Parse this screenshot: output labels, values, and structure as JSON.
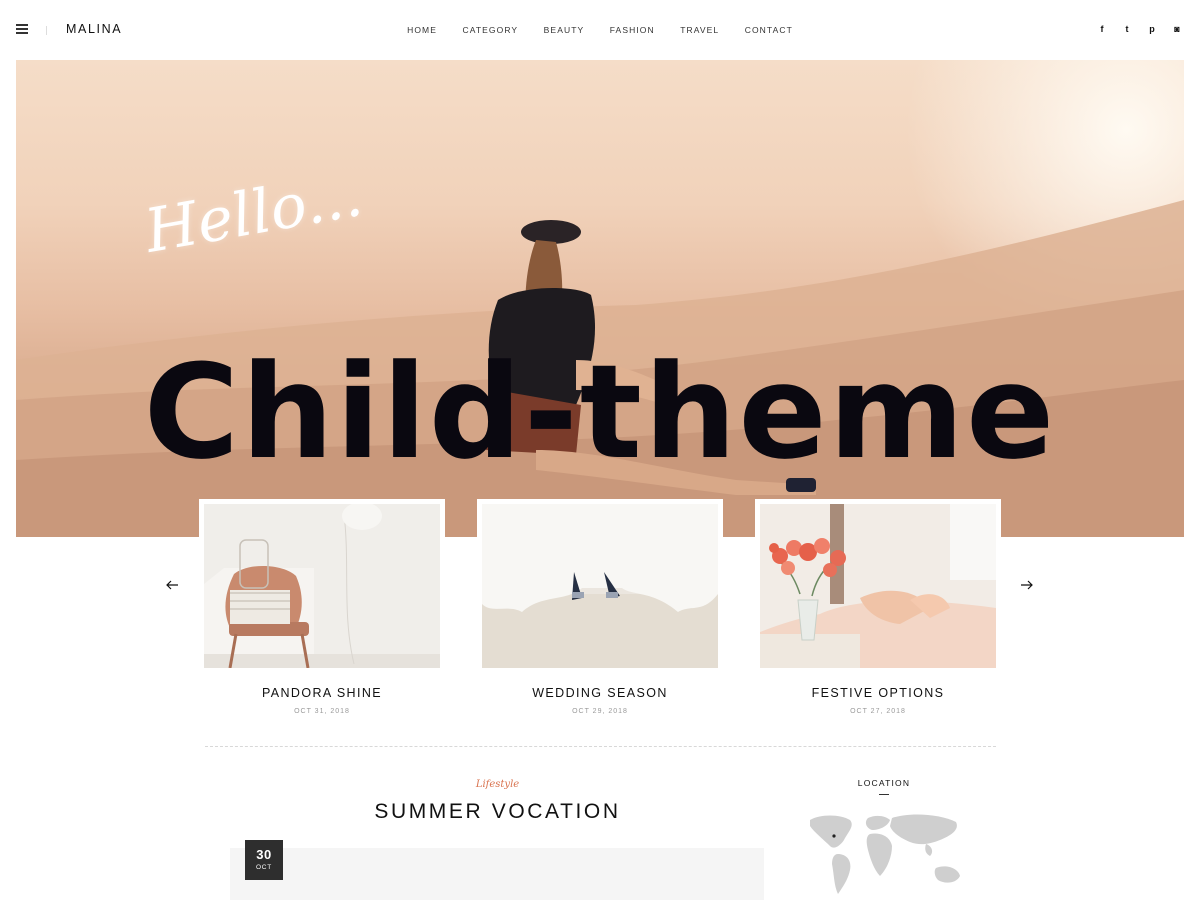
{
  "site": {
    "logo": "MALINA"
  },
  "nav": [
    "HOME",
    "CATEGORY",
    "BEAUTY",
    "FASHION",
    "TRAVEL",
    "CONTACT"
  ],
  "social": [
    {
      "icon": "facebook-icon",
      "glyph": "f"
    },
    {
      "icon": "twitter-icon",
      "glyph": "t"
    },
    {
      "icon": "pinterest-icon",
      "glyph": "p"
    },
    {
      "icon": "instagram-icon",
      "glyph": "◙"
    }
  ],
  "hero": {
    "greeting": "Hello...",
    "watermark": "Child-theme"
  },
  "carousel": [
    {
      "title": "PANDORA SHINE",
      "date": "OCT 31, 2018"
    },
    {
      "title": "WEDDING SEASON",
      "date": "OCT 29, 2018"
    },
    {
      "title": "FESTIVE OPTIONS",
      "date": "OCT 27, 2018"
    }
  ],
  "post": {
    "category": "Lifestyle",
    "title": "SUMMER VOCATION",
    "day": "30",
    "month": "OCT"
  },
  "widget": {
    "title": "LOCATION"
  },
  "colors": {
    "accent": "#d9734f",
    "badge": "#2e2e2e",
    "text": "#111111"
  }
}
